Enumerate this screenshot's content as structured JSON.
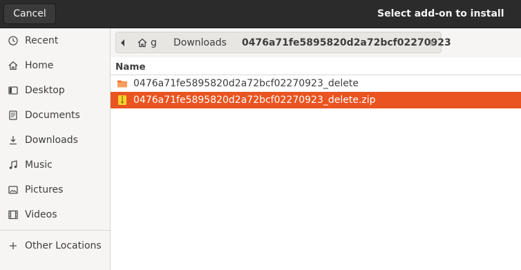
{
  "header": {
    "cancel_label": "Cancel",
    "title": "Select add-on to install"
  },
  "sidebar": {
    "items": [
      {
        "label": "Recent",
        "icon": "clock-icon"
      },
      {
        "label": "Home",
        "icon": "home-icon"
      },
      {
        "label": "Desktop",
        "icon": "desktop-icon"
      },
      {
        "label": "Documents",
        "icon": "document-icon"
      },
      {
        "label": "Downloads",
        "icon": "download-icon"
      },
      {
        "label": "Music",
        "icon": "music-icon"
      },
      {
        "label": "Pictures",
        "icon": "picture-icon"
      },
      {
        "label": "Videos",
        "icon": "video-icon"
      }
    ],
    "other_locations": {
      "label": "Other Locations",
      "icon": "plus-icon"
    }
  },
  "pathbar": {
    "segments": [
      {
        "label": "g",
        "icon": "home-icon"
      },
      {
        "label": "Downloads"
      },
      {
        "label": "0476a71fe5895820d2a72bcf02270923",
        "current": true
      }
    ]
  },
  "file_list": {
    "column_name": "Name",
    "files": [
      {
        "name": "0476a71fe5895820d2a72bcf02270923_delete",
        "icon": "folder-icon",
        "selected": false
      },
      {
        "name": "0476a71fe5895820d2a72bcf02270923_delete.zip",
        "icon": "zip-archive-icon",
        "selected": true
      }
    ]
  },
  "colors": {
    "accent": "#e95420",
    "header_bg": "#2b2b2b",
    "sidebar_bg": "#f6f5f4",
    "folder": "#f37329"
  }
}
